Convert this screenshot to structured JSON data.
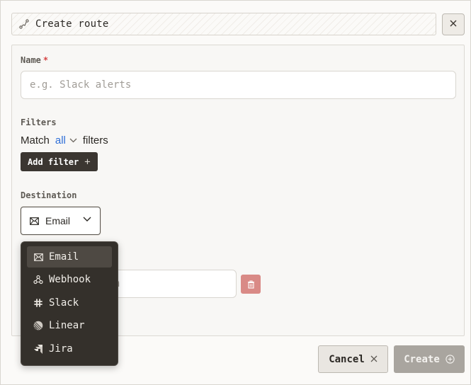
{
  "header": {
    "title": "Create route",
    "title_icon": "route-icon",
    "close_icon": "close-icon"
  },
  "form": {
    "name": {
      "label": "Name",
      "required_marker": "*",
      "placeholder": "e.g. Slack alerts",
      "value": ""
    },
    "filters": {
      "label": "Filters",
      "match_prefix": "Match",
      "match_value": "all",
      "match_suffix": "filters",
      "add_filter_label": "Add filter",
      "add_icon": "+"
    },
    "destination": {
      "label": "Destination",
      "selected": "Email",
      "selected_icon": "email-icon",
      "email_input_visible_text": "om",
      "delete_icon": "trash-icon"
    }
  },
  "dropdown": {
    "items": [
      {
        "label": "Email",
        "icon": "email-icon",
        "active": true
      },
      {
        "label": "Webhook",
        "icon": "webhook-icon",
        "active": false
      },
      {
        "label": "Slack",
        "icon": "slack-icon",
        "active": false
      },
      {
        "label": "Linear",
        "icon": "linear-icon",
        "active": false
      },
      {
        "label": "Jira",
        "icon": "jira-icon",
        "active": false
      }
    ]
  },
  "footer": {
    "cancel_label": "Cancel",
    "create_label": "Create"
  },
  "colors": {
    "primary_dark": "#3b3631",
    "accent_blue": "#2f6fd8",
    "required_red": "#d64545",
    "delete_red": "#d98a86",
    "disabled_gray": "#a9a59f"
  }
}
